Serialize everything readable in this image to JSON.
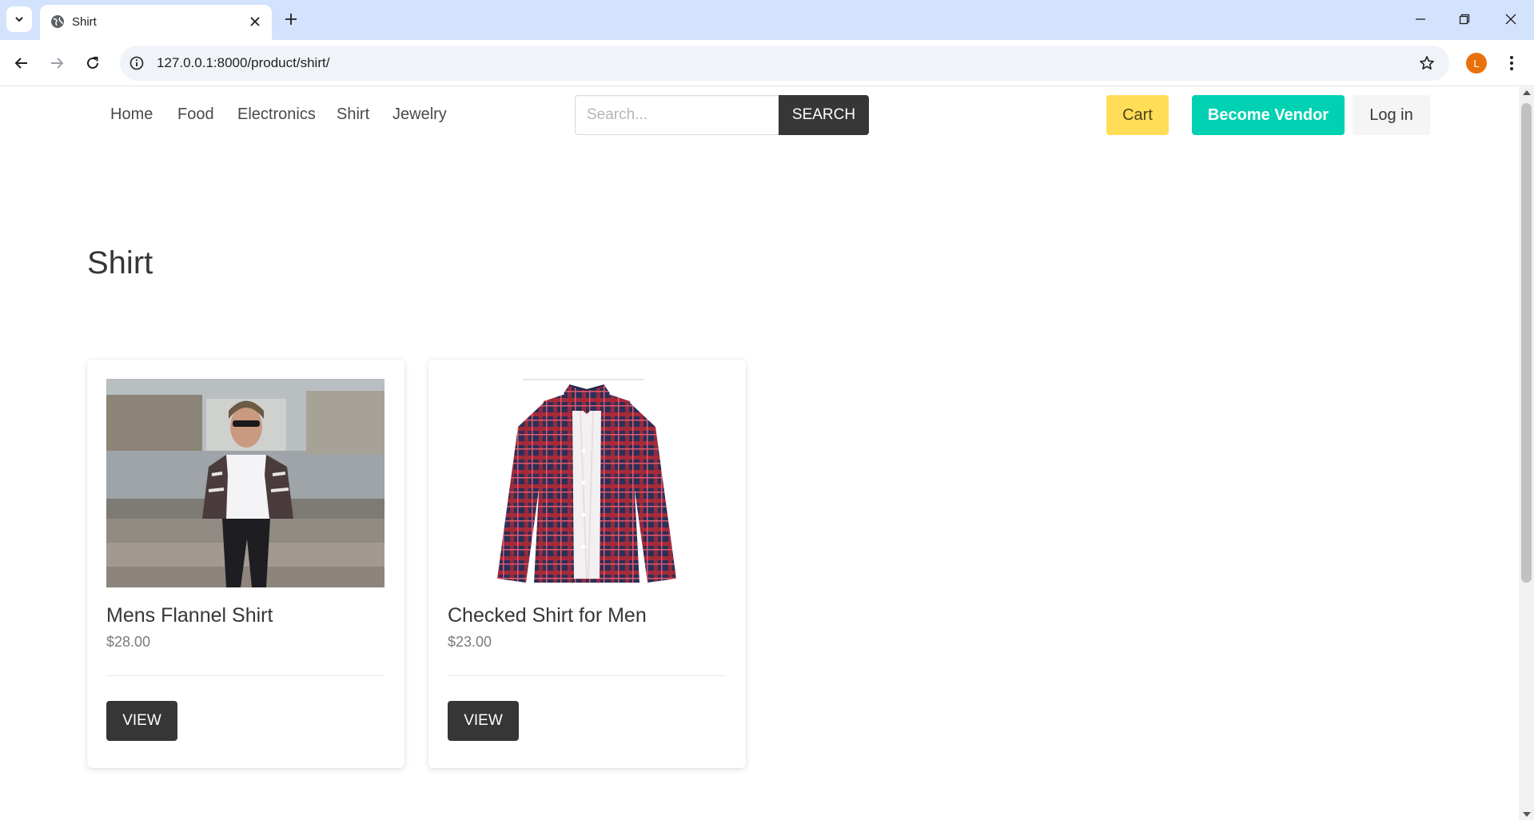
{
  "browser": {
    "tab_title": "Shirt",
    "url": "127.0.0.1:8000/product/shirt/",
    "profile_initial": "L"
  },
  "site": {
    "nav_links": [
      "Home",
      "Food",
      "Electronics",
      "Shirt",
      "Jewelry"
    ],
    "search": {
      "placeholder": "Search...",
      "button_label": "SEARCH"
    },
    "cart_label": "Cart",
    "vendor_label": "Become Vendor",
    "login_label": "Log in"
  },
  "page": {
    "title": "Shirt"
  },
  "products": [
    {
      "name": "Mens Flannel Shirt",
      "price": "$28.00",
      "button_label": "VIEW"
    },
    {
      "name": "Checked Shirt for Men",
      "price": "$23.00",
      "button_label": "VIEW"
    }
  ],
  "colors": {
    "tabstrip": "#d3e3fd",
    "cart": "#ffdd57",
    "vendor": "#00d1b2",
    "dark_button": "#363636",
    "avatar": "#e8710a"
  }
}
